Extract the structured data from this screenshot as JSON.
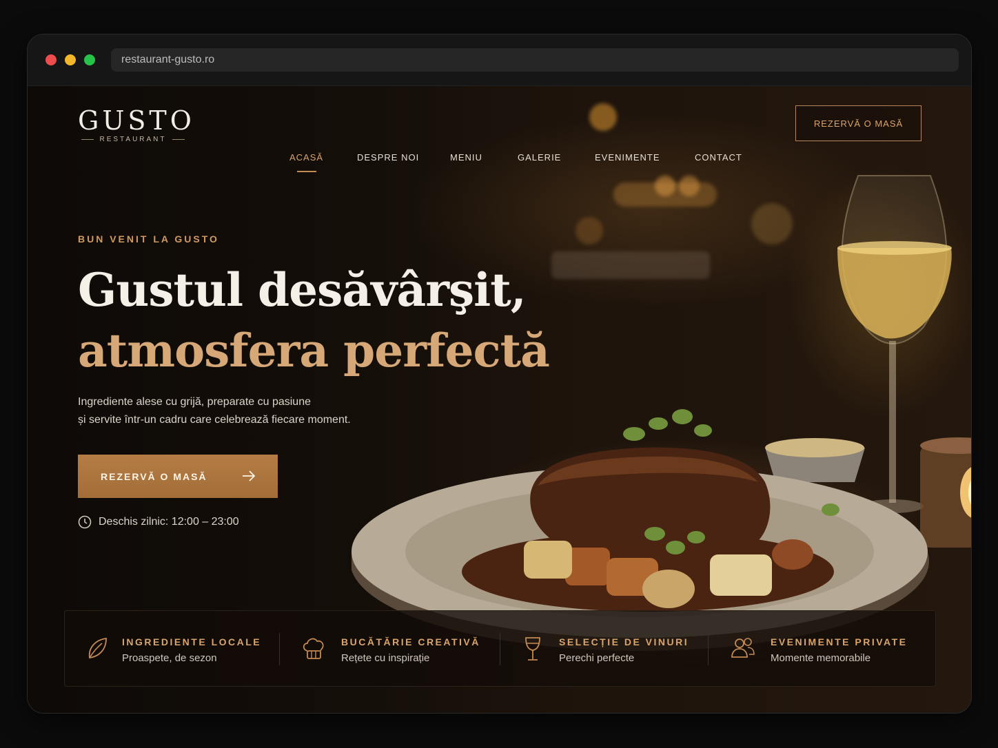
{
  "browser": {
    "url": "restaurant-gusto.ro"
  },
  "brand": {
    "name": "GUSTO",
    "tagline": "RESTAURANT"
  },
  "nav": {
    "items": [
      {
        "label": "ACASĂ",
        "active": true
      },
      {
        "label": "DESPRE NOI",
        "active": false
      },
      {
        "label": "MENIU",
        "active": false
      },
      {
        "label": "GALERIE",
        "active": false
      },
      {
        "label": "EVENIMENTE",
        "active": false
      },
      {
        "label": "CONTACT",
        "active": false
      }
    ],
    "cta_label": "REZERVĂ O MASĂ"
  },
  "hero": {
    "eyebrow": "BUN VENIT LA GUSTO",
    "headline_line1": "Gustul desăvârşit,",
    "headline_line2": "atmosfera perfectă",
    "lead_line1": "Ingrediente alese cu grijă, preparate cu pasiune",
    "lead_line2": "și servite într-un cadru care celebrează fiecare moment.",
    "button_label": "REZERVĂ O MASĂ",
    "hours": "Deschis zilnic: 12:00 – 23:00"
  },
  "features": [
    {
      "title": "INGREDIENTE LOCALE",
      "subtitle": "Proaspete, de sezon",
      "icon": "leaf-icon"
    },
    {
      "title": "BUCĂTĂRIE CREATIVĂ",
      "subtitle": "Rețete cu inspirație",
      "icon": "chef-hat-icon"
    },
    {
      "title": "SELECȚIE DE VINURI",
      "subtitle": "Perechi perfecte",
      "icon": "wine-glass-icon"
    },
    {
      "title": "EVENIMENTE PRIVATE",
      "subtitle": "Momente memorabile",
      "icon": "people-icon"
    }
  ],
  "colors": {
    "accent": "#c48b52",
    "accent_text": "#d9a56d",
    "button": "#ab743e",
    "background": "#140e09"
  }
}
